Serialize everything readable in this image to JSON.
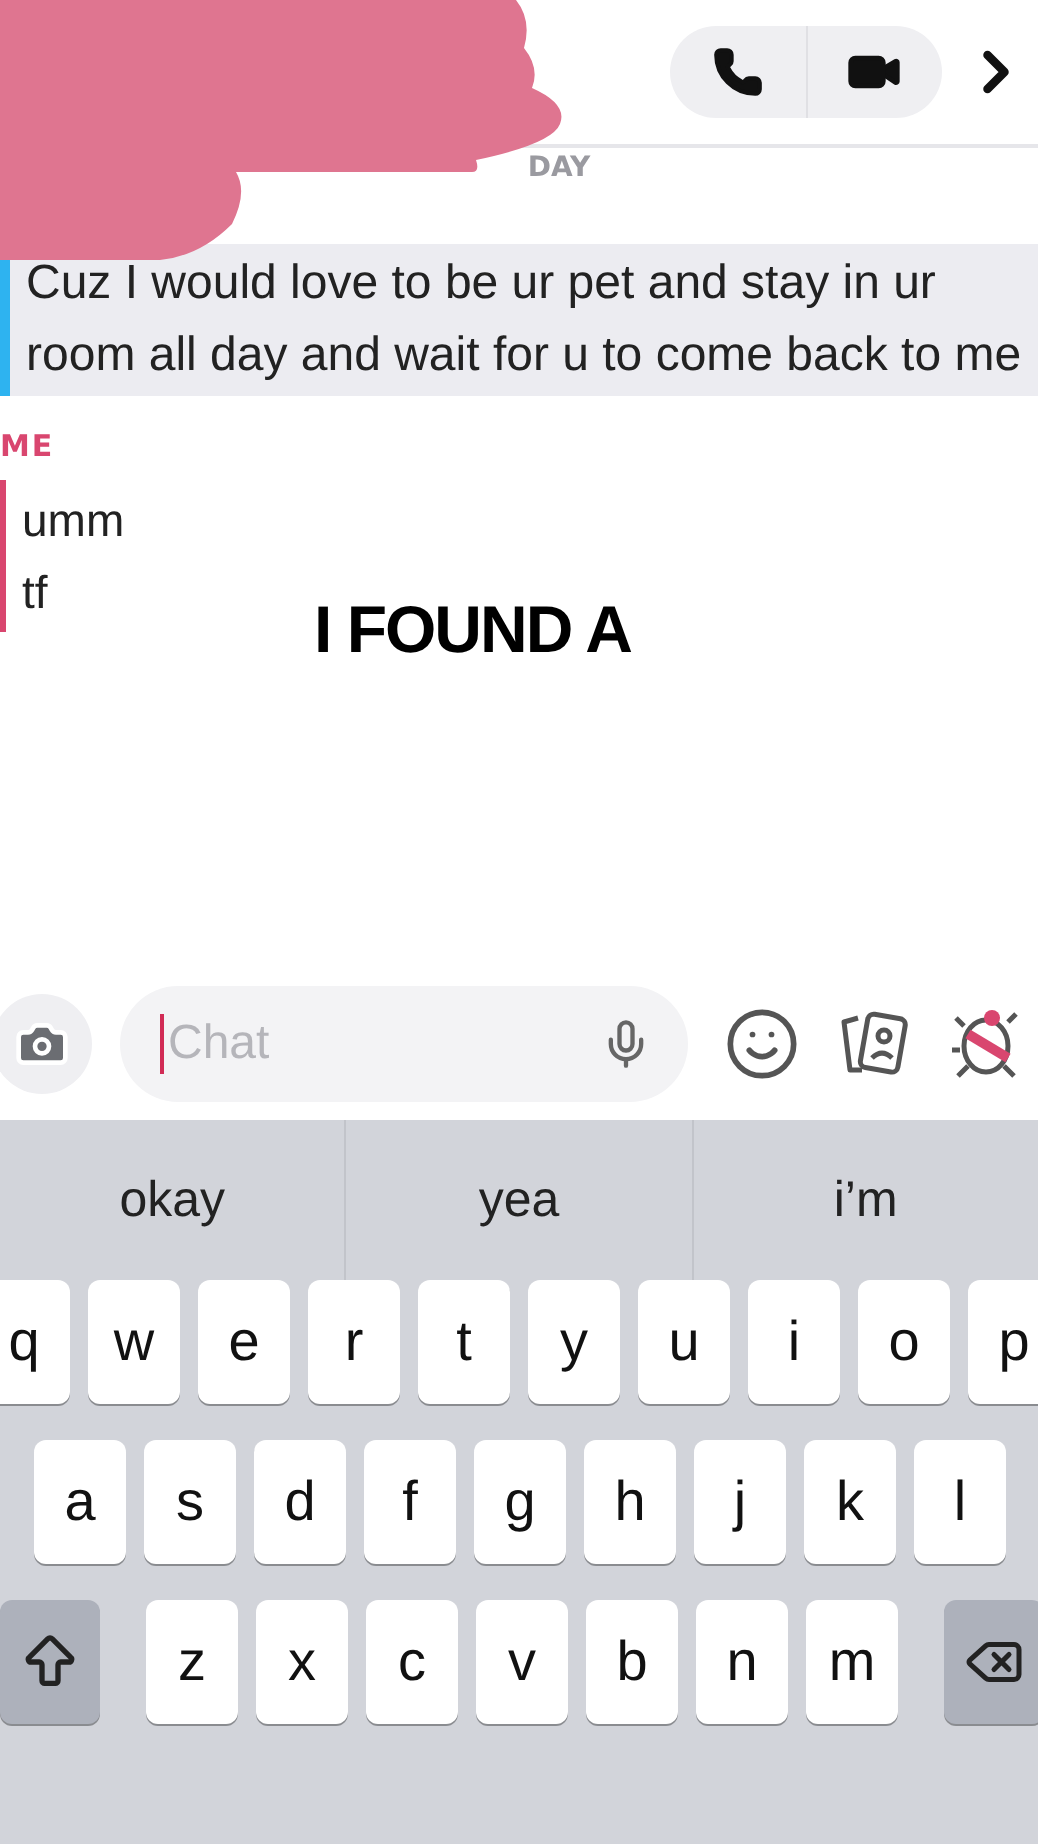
{
  "date_label": "DAY",
  "conversation": [
    {
      "kind": "received",
      "lines": [
        "Cuz I would love to be ur pet and stay in ur room all day and wait for u to come back to me"
      ]
    },
    {
      "kind": "sent",
      "sender": "ME",
      "lines": [
        "umm",
        "tf"
      ]
    }
  ],
  "caption": "I FOUND A",
  "composer": {
    "placeholder": "Chat"
  },
  "suggestions": [
    "okay",
    "yea",
    "i’m"
  ],
  "keyboard_rows": [
    [
      "q",
      "w",
      "e",
      "r",
      "t",
      "y",
      "u",
      "i",
      "o",
      "p"
    ],
    [
      "a",
      "s",
      "d",
      "f",
      "g",
      "h",
      "j",
      "k",
      "l"
    ],
    [
      "z",
      "x",
      "c",
      "v",
      "b",
      "n",
      "m"
    ]
  ]
}
